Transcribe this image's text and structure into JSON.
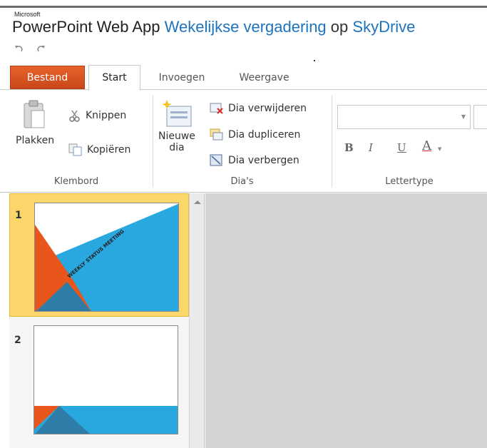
{
  "window": {
    "brand": "Microsoft",
    "app_name": "PowerPoint Web App",
    "document_name": "Wekelijkse vergadering",
    "separator": "op",
    "location": "SkyDrive"
  },
  "quick_access": {
    "undo_icon": "undo-icon",
    "redo_icon": "redo-icon"
  },
  "tabs": [
    {
      "label": "Bestand"
    },
    {
      "label": "Start"
    },
    {
      "label": "Invoegen"
    },
    {
      "label": "Weergave"
    }
  ],
  "ribbon": {
    "clipboard": {
      "paste": "Plakken",
      "cut": "Knippen",
      "copy": "Kopiëren",
      "group_label": "Klembord"
    },
    "slides": {
      "new_slide_line1": "Nieuwe",
      "new_slide_line2": "dia",
      "delete": "Dia verwijderen",
      "duplicate": "Dia dupliceren",
      "hide": "Dia verbergen",
      "group_label": "Dia's"
    },
    "font": {
      "font_name": "",
      "bold": "B",
      "italic": "I",
      "underline": "U",
      "color": "A",
      "group_label": "Lettertype"
    }
  },
  "slides": [
    {
      "number": "1",
      "title_text": "WEEKLY STATUS MEETING",
      "selected": true
    },
    {
      "number": "2",
      "selected": false
    }
  ],
  "colors": {
    "file_tab": "#d9531e",
    "accent_blue": "#29a8e0",
    "accent_orange": "#e8561c",
    "selection": "#fbd66b"
  }
}
